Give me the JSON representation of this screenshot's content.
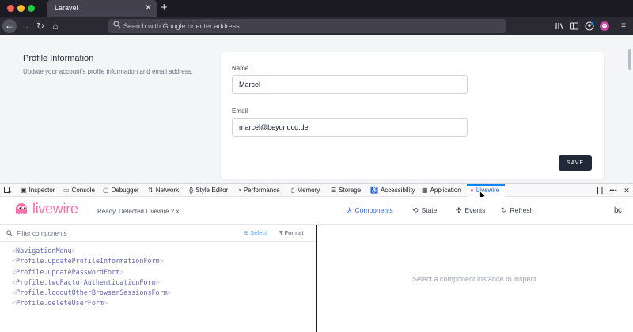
{
  "browser": {
    "tab_title": "Laravel",
    "tab_close": "✕",
    "new_tab": "+",
    "url_placeholder": "Search with Google or enter address",
    "nav": {
      "back": "←",
      "forward": "→",
      "reload": "↻",
      "home": "⌂"
    }
  },
  "page": {
    "section_title": "Profile Information",
    "section_description": "Update your account's profile information and email address.",
    "name_label": "Name",
    "name_value": "Marcel",
    "email_label": "Email",
    "email_value": "marcel@beyondco.de",
    "save_label": "SAVE"
  },
  "devtools": {
    "tabs": [
      {
        "label": "Inspector",
        "icon": "inspector-icon"
      },
      {
        "label": "Console",
        "icon": "console-icon"
      },
      {
        "label": "Debugger",
        "icon": "debugger-icon"
      },
      {
        "label": "Network",
        "icon": "network-icon"
      },
      {
        "label": "Style Editor",
        "icon": "style-editor-icon"
      },
      {
        "label": "Performance",
        "icon": "performance-icon"
      },
      {
        "label": "Memory",
        "icon": "memory-icon"
      },
      {
        "label": "Storage",
        "icon": "storage-icon"
      },
      {
        "label": "Accessibility",
        "icon": "accessibility-icon"
      },
      {
        "label": "Application",
        "icon": "application-icon"
      },
      {
        "label": "Livewire",
        "icon": "livewire-icon",
        "active": true
      }
    ]
  },
  "livewire": {
    "wordmark": "livewire",
    "status": "Ready. Detected Livewire 2.x.",
    "nav": {
      "components": "Components",
      "state": "State",
      "events": "Events",
      "refresh": "Refresh"
    },
    "brand_mark": "bc",
    "filter_placeholder": "Filter components",
    "select_label": "Select",
    "format_label": "Format",
    "components": [
      "NavigationMenu",
      "Profile.updateProfileInformationForm",
      "Profile.updatePasswordForm",
      "Profile.twoFactorAuthenticationForm",
      "Profile.logoutOtherBrowserSessionsForm",
      "Profile.deleteUserForm"
    ],
    "empty_message": "Select a component instance to inspect."
  },
  "colors": {
    "accent_blue": "#0a84ff",
    "livewire_pink": "#fb70a9",
    "save_button": "#1f2937",
    "component_name": "#6366a8"
  }
}
